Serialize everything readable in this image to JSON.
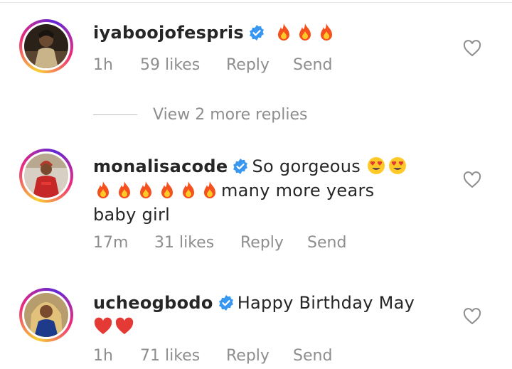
{
  "comments": [
    {
      "username": "iyaboojofespris",
      "text": "",
      "emojis": [
        "fire",
        "fire",
        "fire"
      ],
      "time": "1h",
      "likes": "59 likes",
      "reply": "Reply",
      "send": "Send"
    },
    {
      "username": "monalisacode",
      "text_part1": "So gorgeous",
      "emojis_part1": [
        "heart-eyes",
        "heart-eyes"
      ],
      "emojis_part2": [
        "fire",
        "fire",
        "fire",
        "fire",
        "fire",
        "fire"
      ],
      "text_part2": "many more years",
      "text_part3": "baby girl",
      "time": "17m",
      "likes": "31 likes",
      "reply": "Reply",
      "send": "Send"
    },
    {
      "username": "ucheogbodo",
      "text_part1": "Happy Birthday May",
      "emojis_part2": [
        "red-heart",
        "red-heart"
      ],
      "time": "1h",
      "likes": "71 likes",
      "reply": "Reply",
      "send": "Send"
    }
  ],
  "view_more": "View 2 more replies",
  "colors": {
    "text": "#262626",
    "secondary": "#8e8e8e",
    "verified": "#3897f0"
  }
}
